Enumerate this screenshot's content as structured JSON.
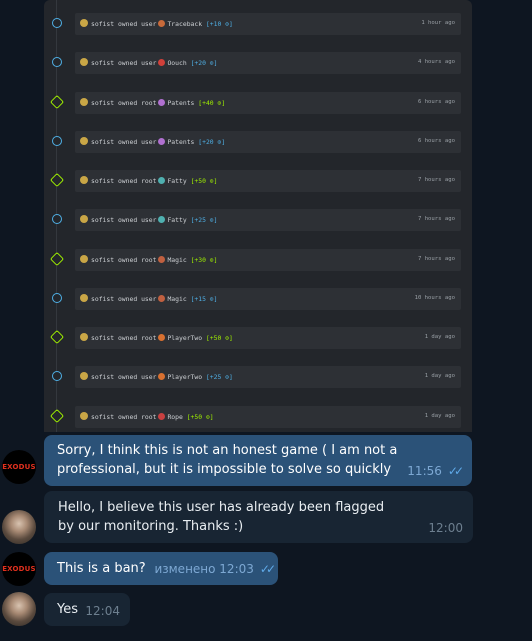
{
  "activity": [
    {
      "user": "sofist",
      "type": "user",
      "machine": "Traceback",
      "points": "[+10 ⊙]",
      "time": "1 hour ago",
      "avatar": "#c86a3a"
    },
    {
      "user": "sofist",
      "type": "user",
      "machine": "Oouch",
      "points": "[+20 ⊙]",
      "time": "4 hours ago",
      "avatar": "#d0403a"
    },
    {
      "user": "sofist",
      "type": "root",
      "machine": "Patents",
      "points": "[+40 ⊙]",
      "time": "6 hours ago",
      "avatar": "#b070d0"
    },
    {
      "user": "sofist",
      "type": "user",
      "machine": "Patents",
      "points": "[+20 ⊙]",
      "time": "6 hours ago",
      "avatar": "#b070d0"
    },
    {
      "user": "sofist",
      "type": "root",
      "machine": "Fatty",
      "points": "[+50 ⊙]",
      "time": "7 hours ago",
      "avatar": "#4fb0b0"
    },
    {
      "user": "sofist",
      "type": "user",
      "machine": "Fatty",
      "points": "[+25 ⊙]",
      "time": "7 hours ago",
      "avatar": "#4fb0b0"
    },
    {
      "user": "sofist",
      "type": "root",
      "machine": "Magic",
      "points": "[+30 ⊙]",
      "time": "7 hours ago",
      "avatar": "#c06040"
    },
    {
      "user": "sofist",
      "type": "user",
      "machine": "Magic",
      "points": "[+15 ⊙]",
      "time": "10 hours ago",
      "avatar": "#c06040"
    },
    {
      "user": "sofist",
      "type": "root",
      "machine": "PlayerTwo",
      "points": "[+50 ⊙]",
      "time": "1 day ago",
      "avatar": "#d87030"
    },
    {
      "user": "sofist",
      "type": "user",
      "machine": "PlayerTwo",
      "points": "[+25 ⊙]",
      "time": "1 day ago",
      "avatar": "#d87030"
    },
    {
      "user": "sofist",
      "type": "root",
      "machine": "Rope",
      "points": "[+50 ⊙]",
      "time": "1 day ago",
      "avatar": "#c84040"
    }
  ],
  "owned_word": "owned",
  "colors": {
    "root": "#9fef00",
    "user": "#4fb0e6",
    "outgoing": "#2b5278",
    "incoming": "#182533"
  },
  "messages": [
    {
      "avatar_text": "EXODUS",
      "text": "Sorry, I think this is not an honest game ( I am not a professional, but it is impossible to solve so quickly",
      "time": "11:56"
    },
    {
      "text": "Hello, I believe this user has already been flagged by our monitoring. Thanks :)",
      "time": "12:00"
    },
    {
      "avatar_text": "EXODUS",
      "text": "This is a ban?",
      "time": "изменено 12:03"
    },
    {
      "text": "Yes",
      "time": "12:04"
    }
  ]
}
